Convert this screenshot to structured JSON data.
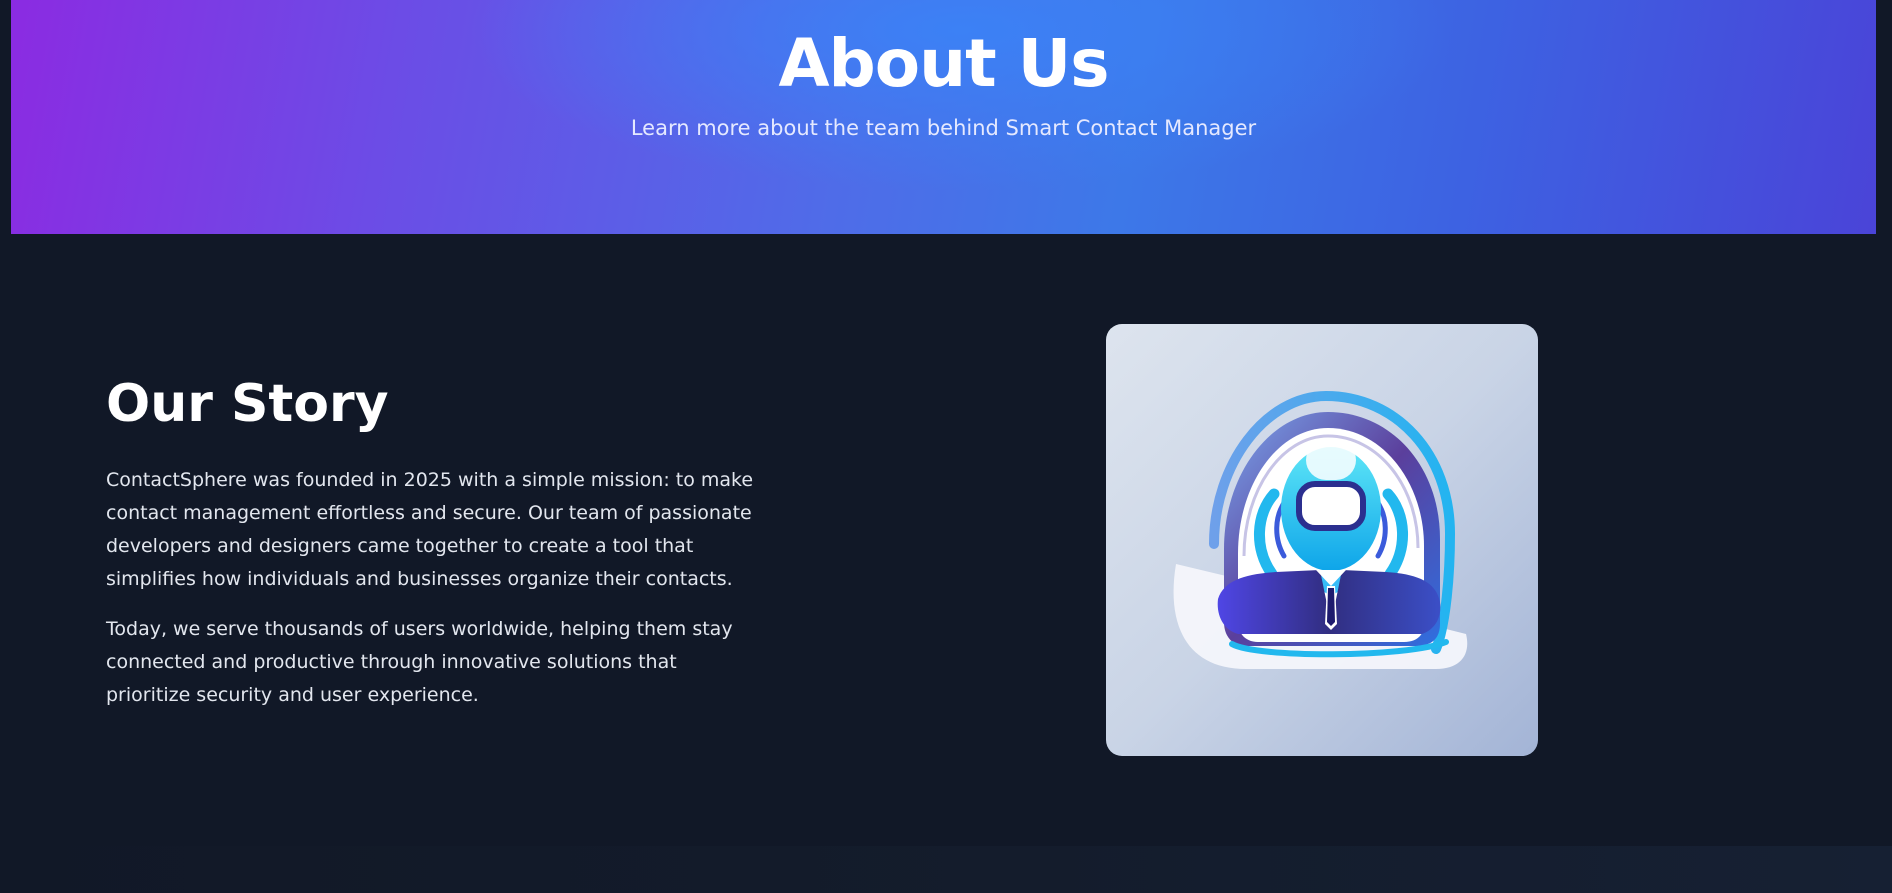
{
  "hero": {
    "title": "About Us",
    "subtitle": "Learn more about the team behind Smart Contact Manager"
  },
  "story": {
    "title": "Our Story",
    "paragraphs": [
      "ContactSphere was founded in 2025 with a simple mission: to make contact management effortless and secure. Our team of passionate developers and designers came together to create a tool that simplifies how individuals and businesses organize their contacts.",
      "Today, we serve thousands of users worldwide, helping them stay connected and productive through innovative solutions that prioritize security and user experience."
    ]
  },
  "logo": {
    "icon": "contact-manager-logo-icon"
  },
  "colors": {
    "page_background": "#111827",
    "hero_start": "#8b2be2",
    "hero_mid": "#3d78e8",
    "hero_end": "#4a44d8",
    "logo_cyan": "#22d3ee",
    "logo_navy": "#1e1b6e"
  }
}
